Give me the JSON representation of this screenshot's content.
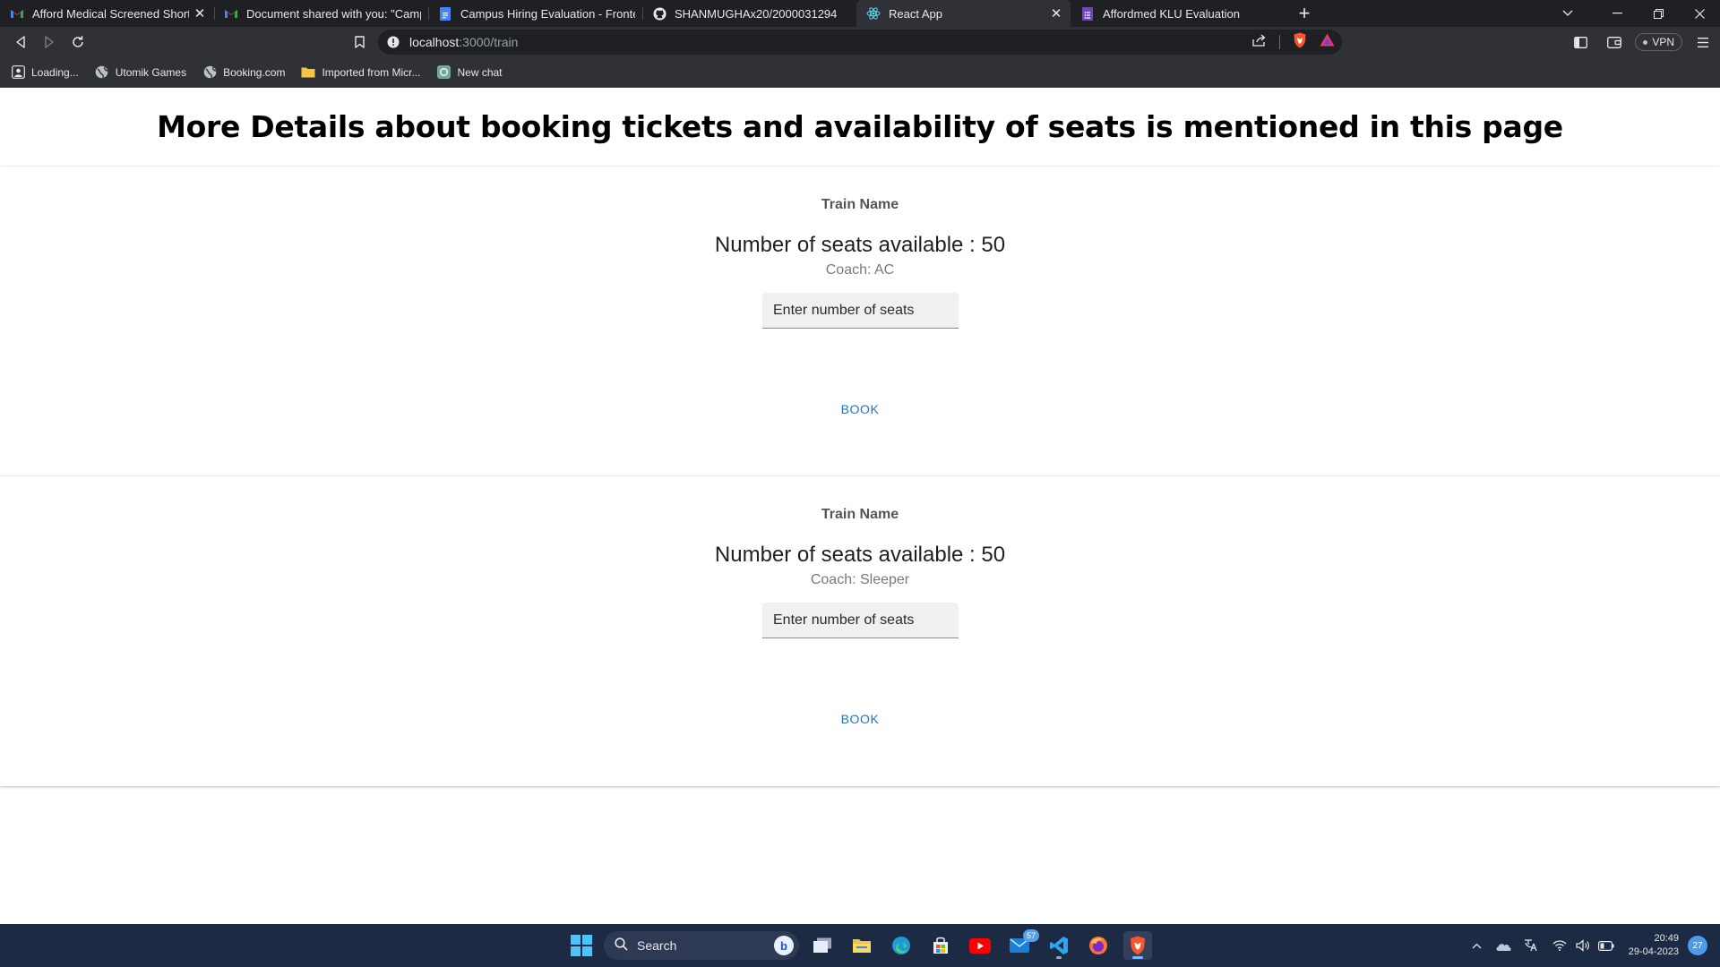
{
  "browser": {
    "tabs": [
      {
        "title": "Afford Medical Screened Shortlisted",
        "favicon": "gmail-icon",
        "active": false,
        "has_close": true
      },
      {
        "title": "Document shared with you: \"Campus Hiring",
        "favicon": "gmail-icon",
        "active": false,
        "has_close": false
      },
      {
        "title": "Campus Hiring Evaluation - Frontend",
        "favicon": "docs-icon",
        "active": false,
        "has_close": false
      },
      {
        "title": "SHANMUGHAx20/2000031294",
        "favicon": "github-icon",
        "active": false,
        "has_close": false
      },
      {
        "title": "React App",
        "favicon": "react-icon",
        "active": true,
        "has_close": true
      },
      {
        "title": "Affordmed KLU Evaluation",
        "favicon": "forms-icon",
        "active": false,
        "has_close": false
      }
    ],
    "newtab_label": "+",
    "url_host": "localhost",
    "url_path": ":3000/train",
    "vpn_label": "VPN",
    "bookmarks": [
      {
        "label": "Loading...",
        "icon": "page-icon"
      },
      {
        "label": "Utomik Games",
        "icon": "globe-icon"
      },
      {
        "label": "Booking.com",
        "icon": "globe-icon"
      },
      {
        "label": "Imported from Micr...",
        "icon": "folder-icon"
      },
      {
        "label": "New chat",
        "icon": "chatgpt-icon"
      }
    ]
  },
  "page": {
    "heading": "More Details about booking tickets and availability of seats is mentioned in this page",
    "trains": [
      {
        "name": "Train Name",
        "seats_text": "Number of seats available : 50",
        "coach_text": "Coach: AC",
        "input_placeholder": "Enter number of seats",
        "book_label": "BOOK"
      },
      {
        "name": "Train Name",
        "seats_text": "Number of seats available : 50",
        "coach_text": "Coach: Sleeper",
        "input_placeholder": "Enter number of seats",
        "book_label": "BOOK"
      }
    ]
  },
  "taskbar": {
    "search_label": "Search",
    "mail_badge": "57",
    "time": "20:49",
    "date": "29-04-2023",
    "notification_count": "27"
  },
  "colors": {
    "tabstrip": "#1f2023",
    "toolbar": "#2f3136",
    "book_button": "#1976d2",
    "taskbar": "#1d2a44"
  }
}
